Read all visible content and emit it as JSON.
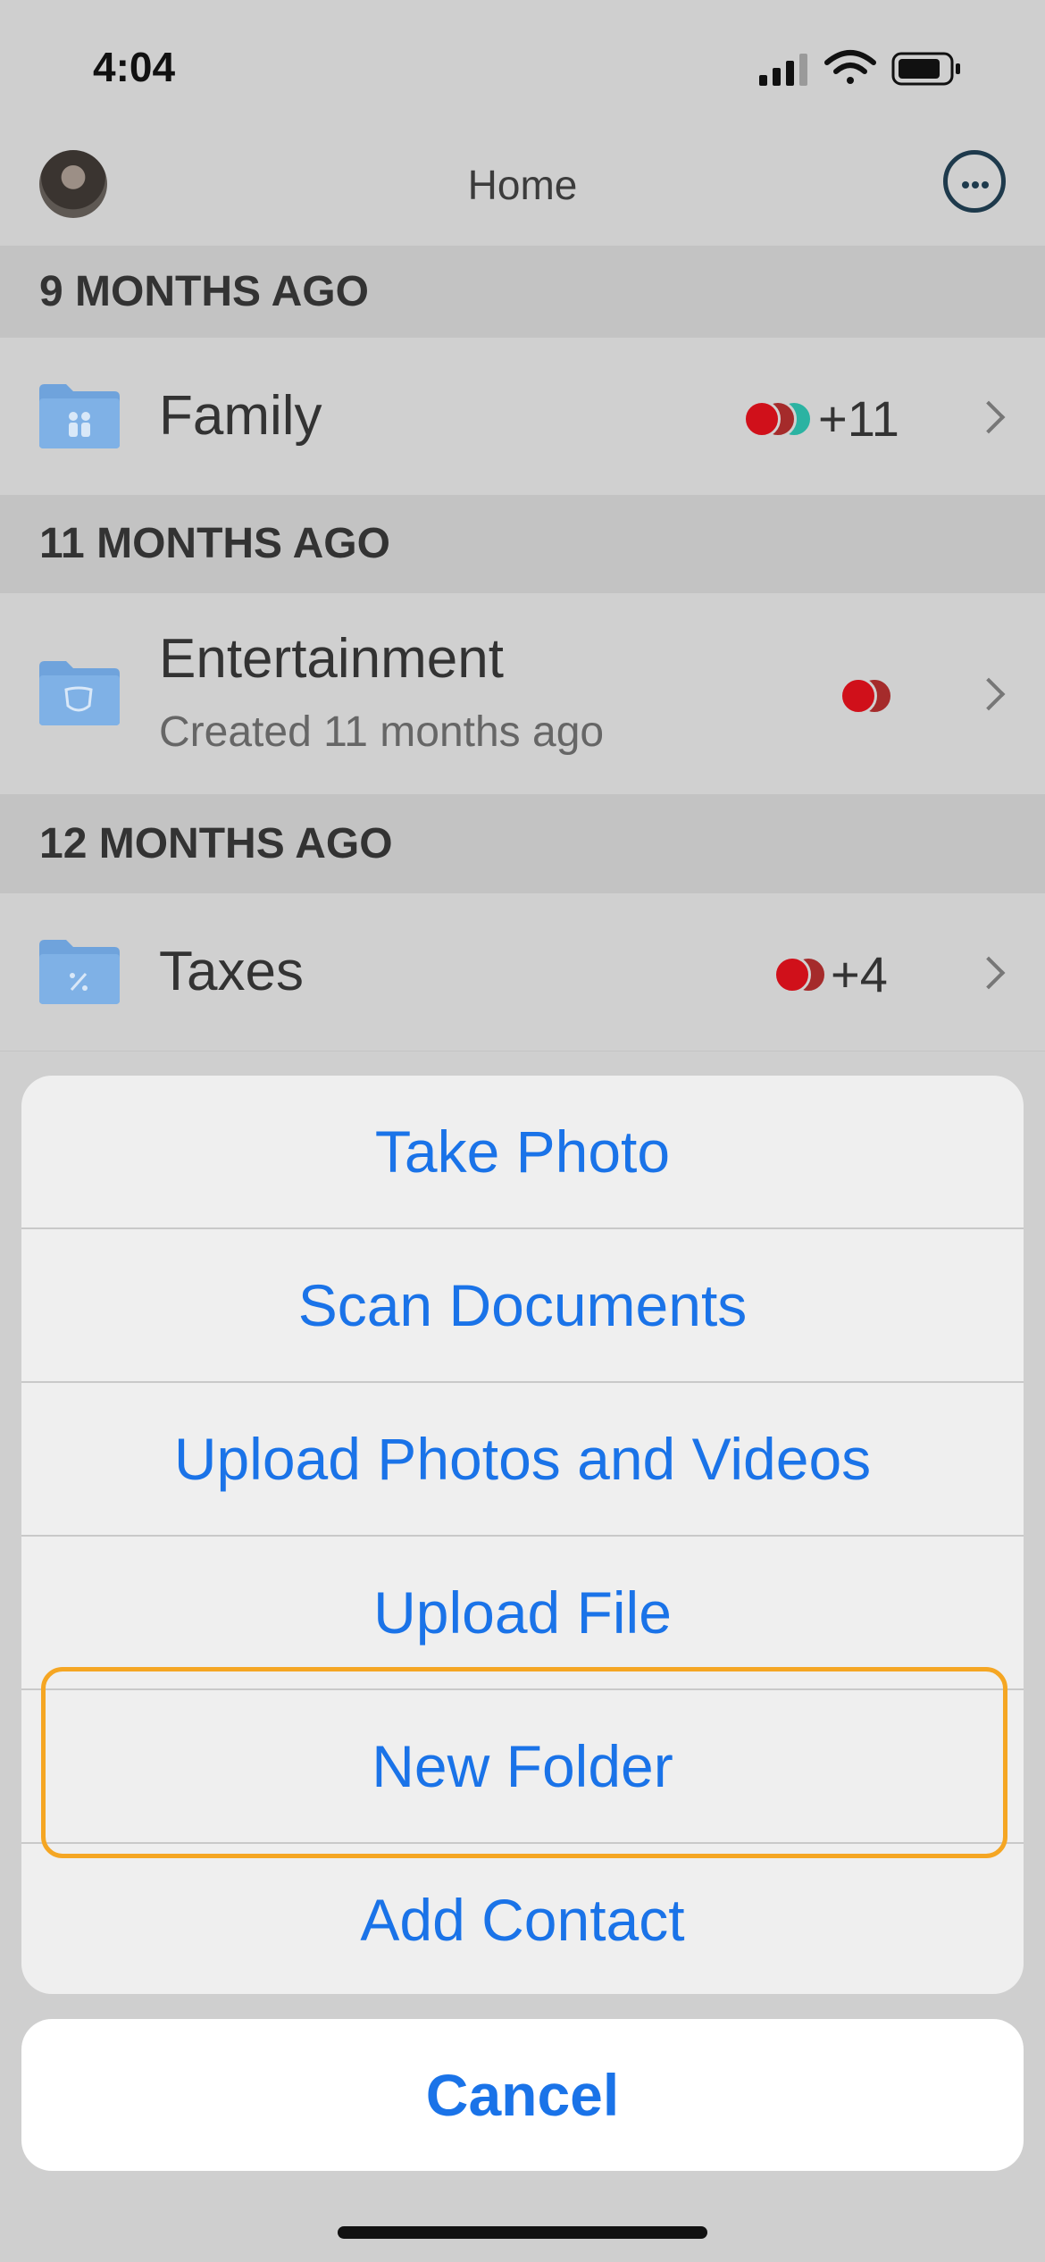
{
  "status_bar": {
    "time": "4:04"
  },
  "nav": {
    "title": "Home",
    "avatar": "avatar",
    "more_icon": "more-icon"
  },
  "sections": [
    {
      "header": "9 MONTHS AGO",
      "items": [
        {
          "title": "Family",
          "count": "+11",
          "icon": "family-folder-icon"
        }
      ]
    },
    {
      "header": "11 MONTHS AGO",
      "items": [
        {
          "title": "Entertainment",
          "subtitle": "Created 11 months ago",
          "icon": "entertainment-folder-icon"
        }
      ]
    },
    {
      "header": "12 MONTHS AGO",
      "items": [
        {
          "title": "Taxes",
          "count": "+4",
          "icon": "taxes-folder-icon"
        }
      ]
    }
  ],
  "action_sheet": {
    "items": [
      {
        "label": "Take Photo"
      },
      {
        "label": "Scan Documents"
      },
      {
        "label": "Upload Photos and Videos"
      },
      {
        "label": "Upload File"
      },
      {
        "label": "New Folder",
        "highlighted": true
      },
      {
        "label": "Add Contact"
      }
    ],
    "cancel": "Cancel"
  },
  "colors": {
    "accent": "#1a73e8",
    "highlight": "#f5a623",
    "red_dot": "#d0101a",
    "teal_dot": "#2bb3a2"
  }
}
